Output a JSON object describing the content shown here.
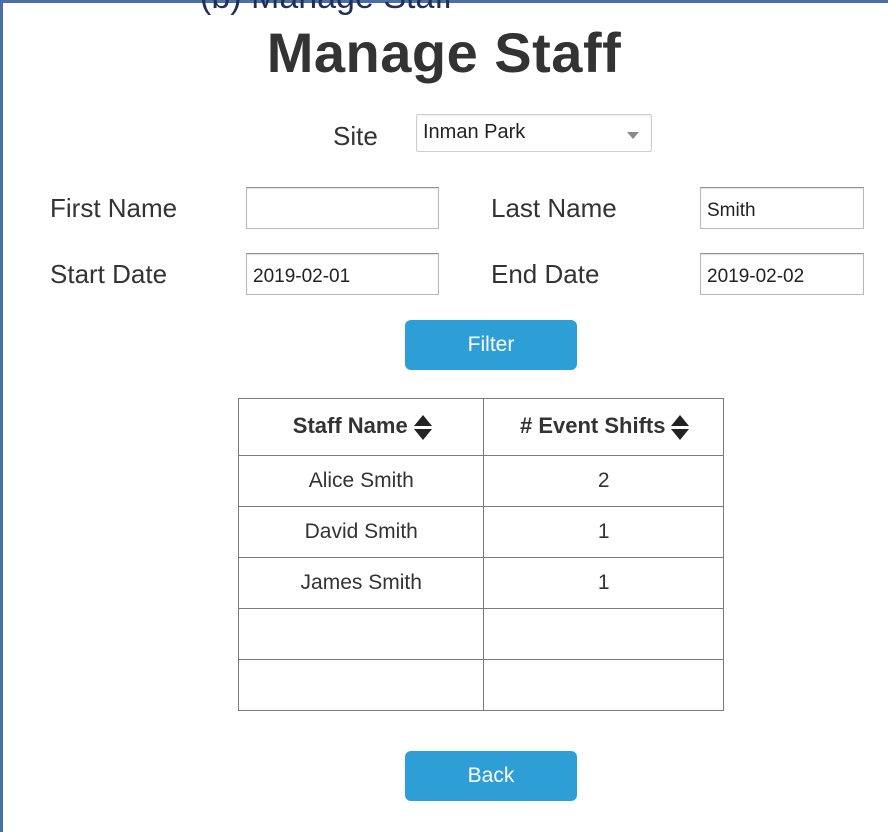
{
  "caption": "(b) Manage Staff",
  "page": {
    "title": "Manage Staff"
  },
  "site": {
    "label": "Site",
    "selected": "Inman Park"
  },
  "filters": {
    "first_name_label": "First Name",
    "first_name_value": "",
    "last_name_label": "Last Name",
    "last_name_value": "Smith",
    "start_date_label": "Start Date",
    "start_date_value": "2019-02-01",
    "end_date_label": "End Date",
    "end_date_value": "2019-02-02"
  },
  "buttons": {
    "filter": "Filter",
    "back": "Back"
  },
  "table": {
    "columns": [
      "Staff Name",
      "# Event Shifts"
    ],
    "rows": [
      [
        "Alice Smith",
        "2"
      ],
      [
        "David Smith",
        "1"
      ],
      [
        "James Smith",
        "1"
      ],
      [
        "",
        ""
      ],
      [
        "",
        ""
      ]
    ]
  },
  "colors": {
    "button": "#2e9fd6",
    "frame": "#4a6fa5",
    "text": "#333333"
  },
  "icons": {
    "sort": "sort-icon",
    "dropdown": "chevron-down-icon"
  }
}
